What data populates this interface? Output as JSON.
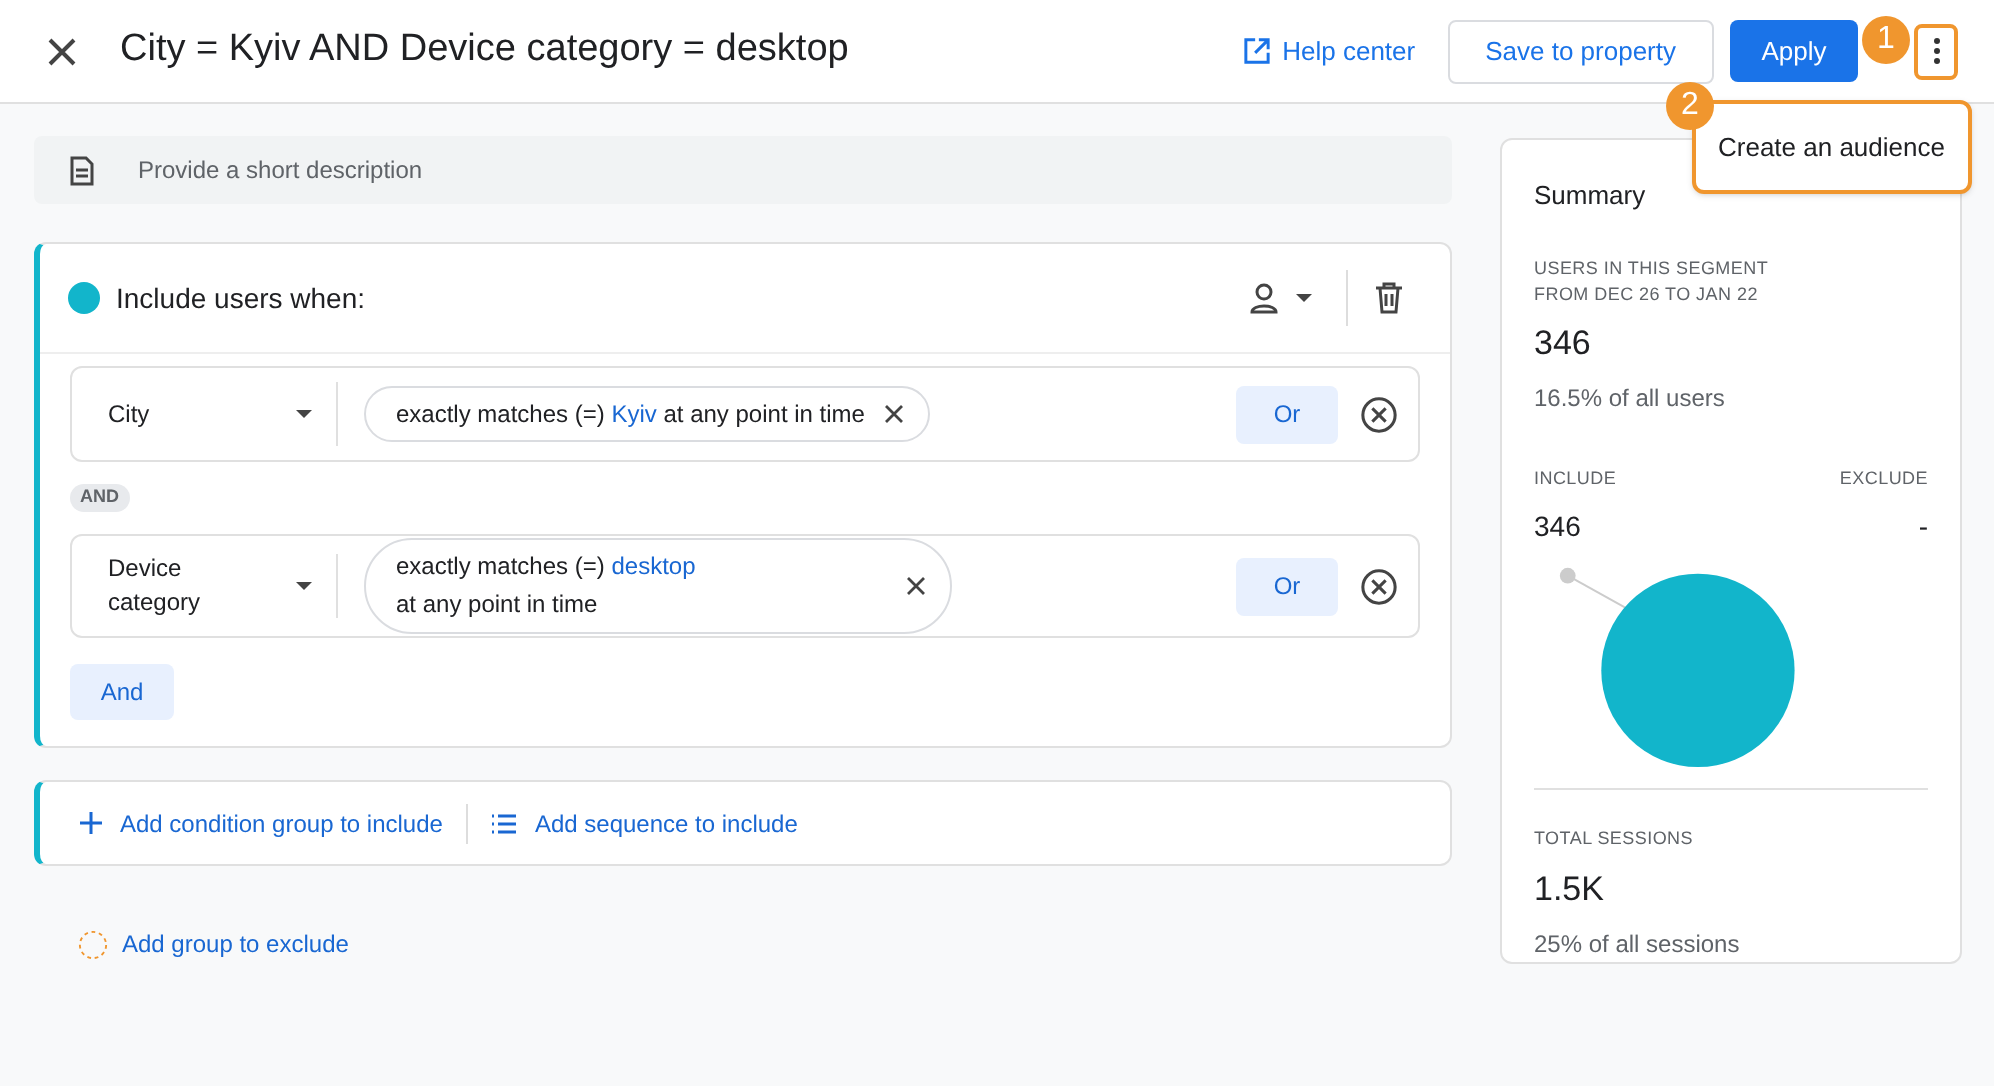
{
  "header": {
    "title": "City = Kyiv AND Device category = desktop",
    "help_link": "Help center",
    "save_button": "Save to property",
    "apply_button": "Apply"
  },
  "callouts": [
    {
      "label": "1"
    },
    {
      "label": "2"
    }
  ],
  "menu": {
    "items": [
      "Create an audience"
    ]
  },
  "description": {
    "placeholder": "Provide a short description"
  },
  "include_group": {
    "title": "Include users when:",
    "color": "#12b5cb",
    "conditions": [
      {
        "dimension": "City",
        "operator": "exactly matches (=)",
        "value": "Kyiv",
        "suffix": "at any point in time",
        "kind": "inline",
        "or_button": "Or"
      },
      {
        "dimension": "Device category",
        "operator": "exactly matches (=)",
        "value": "desktop",
        "suffix": "at any point in time",
        "kind": "stacked",
        "or_button": "Or"
      }
    ],
    "joiner": "AND",
    "and_button": "And"
  },
  "add_links": {
    "condition_group": "Add condition group to include",
    "sequence": "Add sequence to include",
    "exclude": "Add group to exclude"
  },
  "summary": {
    "title": "Summary",
    "users_label_lines": [
      "USERS IN THIS SEGMENT",
      "FROM DEC 26 TO JAN 22"
    ],
    "users_value": "346",
    "users_share": "16.5% of all users",
    "include_label": "INCLUDE",
    "exclude_label": "EXCLUDE",
    "include_value": "346",
    "exclude_value": "-",
    "sessions_label": "TOTAL SESSIONS",
    "sessions_value": "1.5K",
    "sessions_share": "25% of all sessions"
  }
}
